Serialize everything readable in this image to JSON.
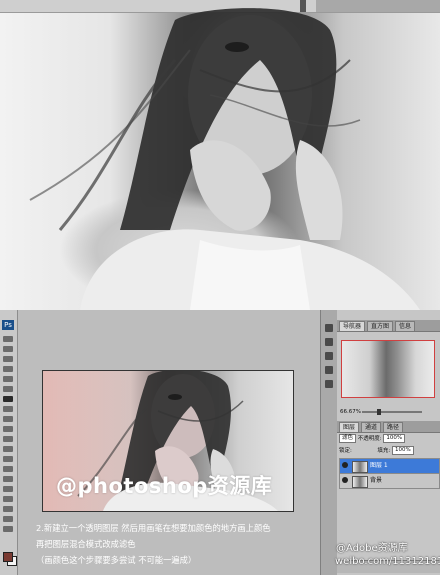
{
  "top_photo": {
    "description_icon": "portrait-photo"
  },
  "document": {
    "watermark": "@photoshop资源库"
  },
  "instructions": [
    "2.新建立一个透明图层 然后用画笔在想要加颜色的地方画上颜色",
    "再把图层混合模式改成滤色",
    "（画颜色这个步骤要多尝试 不可能一遍成）"
  ],
  "toolbar": {
    "logo": "Ps"
  },
  "navigator_panel": {
    "tabs": [
      "导航器",
      "直方图",
      "信息"
    ],
    "zoom": "66.67%"
  },
  "layers_panel": {
    "tabs": [
      "图层",
      "通道",
      "路径"
    ],
    "blend_mode": "滤色",
    "opacity_label": "不透明度:",
    "opacity_value": "100%",
    "lock_label": "锁定:",
    "fill_label": "填充:",
    "fill_value": "100%",
    "layers": [
      {
        "name": "图层 1",
        "selected": true
      },
      {
        "name": "背景",
        "selected": false
      }
    ]
  },
  "credit": {
    "weibo_name": "@Adobe资源库",
    "weibo_url": "weibo.com/1131218197"
  },
  "colors": {
    "foreground_swatch": "#7a3a32",
    "background_swatch": "#f5f5f5",
    "layer_selected": "#3d7ad8"
  }
}
